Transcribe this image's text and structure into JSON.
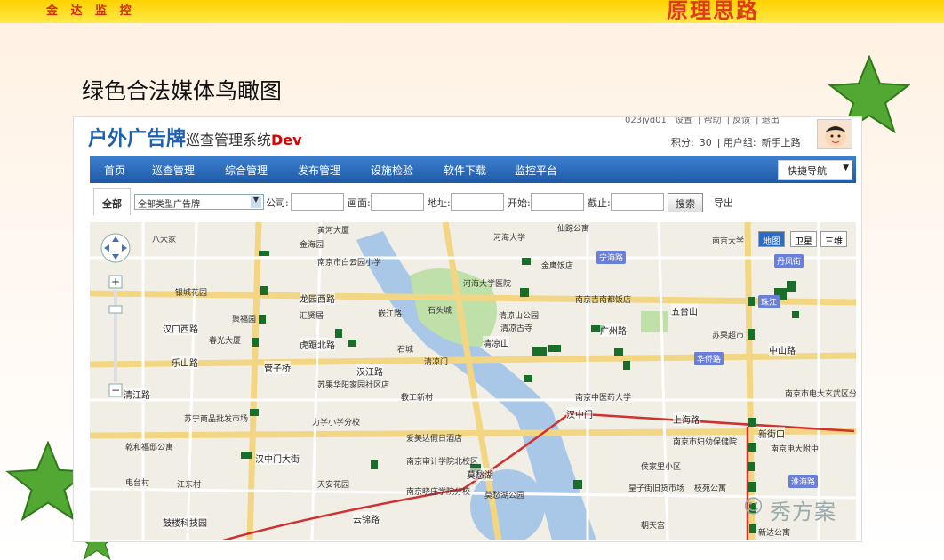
{
  "slide": {
    "brand": "金 达 监 控",
    "heading": "原理思路",
    "title": "绿色合法媒体鸟瞰图"
  },
  "app": {
    "logo_main": "户外广告牌",
    "logo_sub": "巡查管理系统",
    "logo_dev": "Dev"
  },
  "user": {
    "name": "023jyd01",
    "links": [
      "设置",
      "帮助",
      "反馈",
      "退出"
    ],
    "points_label": "积分:",
    "points": "30",
    "group_label": "用户组:",
    "group": "新手上路"
  },
  "nav": {
    "items": [
      "首页",
      "巡查管理",
      "综合管理",
      "发布管理",
      "设施检验",
      "软件下载",
      "监控平台"
    ],
    "quick": "快捷导航"
  },
  "filter": {
    "tab_all": "全部",
    "select_value": "全部类型广告牌",
    "company": "公司:",
    "screen": "画面:",
    "address": "地址:",
    "start": "开始:",
    "end": "截止:",
    "search": "搜索",
    "export": "导出"
  },
  "map": {
    "types": [
      "地图",
      "卫星",
      "三维"
    ],
    "roads": [
      {
        "t": "龙园西路"
      },
      {
        "t": "汉中门大街"
      },
      {
        "t": "汉中门"
      },
      {
        "t": "上海路"
      },
      {
        "t": "广州路"
      },
      {
        "t": "五台山"
      },
      {
        "t": "清凉山"
      },
      {
        "t": "莫愁湖"
      },
      {
        "t": "云锦路"
      },
      {
        "t": "管子桥"
      },
      {
        "t": "新街口"
      },
      {
        "t": "乐山路"
      },
      {
        "t": "鼓楼科技园"
      },
      {
        "t": "汉口西路"
      },
      {
        "t": "虎踞北路"
      },
      {
        "t": "清江路"
      },
      {
        "t": "中山路"
      },
      {
        "t": "汉江路"
      }
    ],
    "routes": [
      "宁海路",
      "丹凤街",
      "华侨路",
      "珠江",
      "淮海路"
    ],
    "pois": [
      "八大家",
      "黄河大厦",
      "金海园",
      "南京市白云园小学",
      "河海大学",
      "仙踪公寓",
      "金鹰饭店",
      "南京大学",
      "银城花园",
      "汇贤居",
      "聚福园",
      "春光大厦",
      "清凉山公园",
      "清凉古寺",
      "南京吉南都饭店",
      "苏果超市",
      "石头城",
      "嵌江路",
      "苏果华阳家园社区店",
      "教工新村",
      "南京中医药大学",
      "南京市电大玄武区分校",
      "苏宁商品批发市场",
      "力学小学分校",
      "乾和福邸公寓",
      "爱美达假日酒店",
      "南京审计学院北校区",
      "南京市妇幼保健院",
      "南京电大附中",
      "电台村",
      "江东村",
      "天安花园",
      "南京晓庄学院分校",
      "莫愁湖公园",
      "皇子街旧货市场",
      "枝苑公寓",
      "朝天宫",
      "新达公寓",
      "侯家里小区",
      "清凉门",
      "石城",
      "河海大学医院"
    ]
  },
  "watermark": "秀方案",
  "colors": {
    "nav": "#1f5aa8",
    "marker": "#1a6e2a",
    "route": "#d03030",
    "water": "#a9c8e8",
    "park": "#bfe0a8"
  }
}
